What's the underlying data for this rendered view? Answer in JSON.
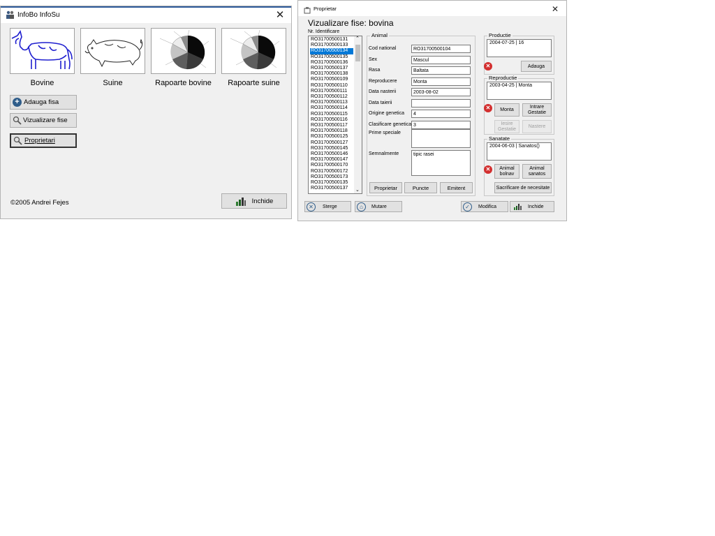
{
  "main_window": {
    "title": "InfoBo InfoSu",
    "thumbnails": [
      {
        "label": "Bovine",
        "icon": "cow-icon"
      },
      {
        "label": "Suine",
        "icon": "pig-icon"
      },
      {
        "label": "Rapoarte bovine",
        "icon": "pie-chart-icon"
      },
      {
        "label": "Rapoarte suine",
        "icon": "pie-chart-icon"
      }
    ],
    "buttons": {
      "add": "Adauga fisa",
      "view": "Vizualizare fise",
      "owners": "Proprietari",
      "close": "Inchide"
    },
    "copyright": "©2005 Andrei Fejes"
  },
  "dialog": {
    "title": "Proprietar",
    "heading": "Vizualizare fise: bovina",
    "list_label": "Nr. Identificare",
    "ids": [
      "RO31700500131",
      "RO31700500133",
      "RO31700500134",
      "RO31700500135",
      "RO31700500136",
      "RO31700500137",
      "RO31700500138",
      "RO31700500109",
      "RO31700500110",
      "RO31700500111",
      "RO31700500112",
      "RO31700500113",
      "RO31700500114",
      "RO31700500115",
      "RO31700500116",
      "RO31700500117",
      "RO31700500118",
      "RO31700500125",
      "RO31700500127",
      "RO31700500145",
      "RO31700500146",
      "RO31700500147",
      "RO31700500170",
      "RO31700500172",
      "RO31700500173",
      "RO31700500135",
      "RO31700500137"
    ],
    "selected_index": 2,
    "animal": {
      "group_title": "Animal",
      "fields": [
        {
          "label": "Cod national",
          "value": "RO31700500104"
        },
        {
          "label": "Sex",
          "value": "Mascul"
        },
        {
          "label": "Rasa",
          "value": "Baltata"
        },
        {
          "label": "Reproducere",
          "value": "Monta"
        },
        {
          "label": "Data nasterii",
          "value": "2003-08-02"
        },
        {
          "label": "Data taierii",
          "value": ""
        },
        {
          "label": "Origine genetica",
          "value": "4"
        },
        {
          "label": "Clasificare genetica",
          "value": "3"
        }
      ],
      "prime_label": "Prime speciale",
      "prime_value": "",
      "semn_label": "Semnalmente",
      "semn_value": "tipic rasei",
      "btn_owner": "Proprietar",
      "btn_points": "Puncte",
      "btn_emitent": "Emitent"
    },
    "productie": {
      "title": "Productie",
      "entries": [
        "2004-07-25 | 16"
      ],
      "btn_add": "Adauga"
    },
    "reproductie": {
      "title": "Reproductie",
      "entries": [
        "2003-04-25 | Monta"
      ],
      "btn_monta": "Monta",
      "btn_intrare_1": "Intrare",
      "btn_intrare_2": "Gestatie",
      "btn_iesire_1": "Iesire",
      "btn_iesire_2": "Gestatie",
      "btn_nastere": "Nastere"
    },
    "sanatate": {
      "title": "Sanatate",
      "entries": [
        "2004-06-03 | Sanatos()"
      ],
      "btn_bolnav_1": "Animal",
      "btn_bolnav_2": "bolnav",
      "btn_sanatos_1": "Animal",
      "btn_sanatos_2": "sanatos",
      "btn_sacrificare": "Sacrificare de necesitate"
    },
    "bottom": {
      "delete": "Sterge",
      "move": "Mutare",
      "modify": "Modifica",
      "close": "Inchide"
    }
  }
}
